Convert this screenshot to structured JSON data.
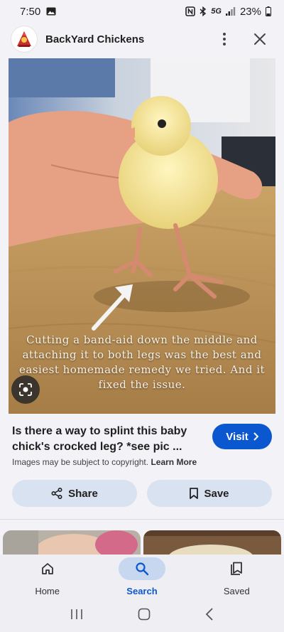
{
  "status_bar": {
    "time": "7:50",
    "battery": "23%",
    "network": "5G"
  },
  "header": {
    "site_name": "BackYard Chickens"
  },
  "image": {
    "caption": "Cutting a band-aid down the middle and attaching it to both legs was the best and easiest homemade remedy we tried. And it fixed the issue."
  },
  "result": {
    "title": "Is there a way to splint this baby chick's crocked leg? *see pic ...",
    "visit_label": "Visit",
    "copyright_text": "Images may be subject to copyright.",
    "learn_more": "Learn More"
  },
  "actions": {
    "share_label": "Share",
    "save_label": "Save"
  },
  "bottom_nav": {
    "home": "Home",
    "search": "Search",
    "saved": "Saved"
  },
  "colors": {
    "accent": "#0b57d0",
    "pill": "#d9e2f0"
  }
}
